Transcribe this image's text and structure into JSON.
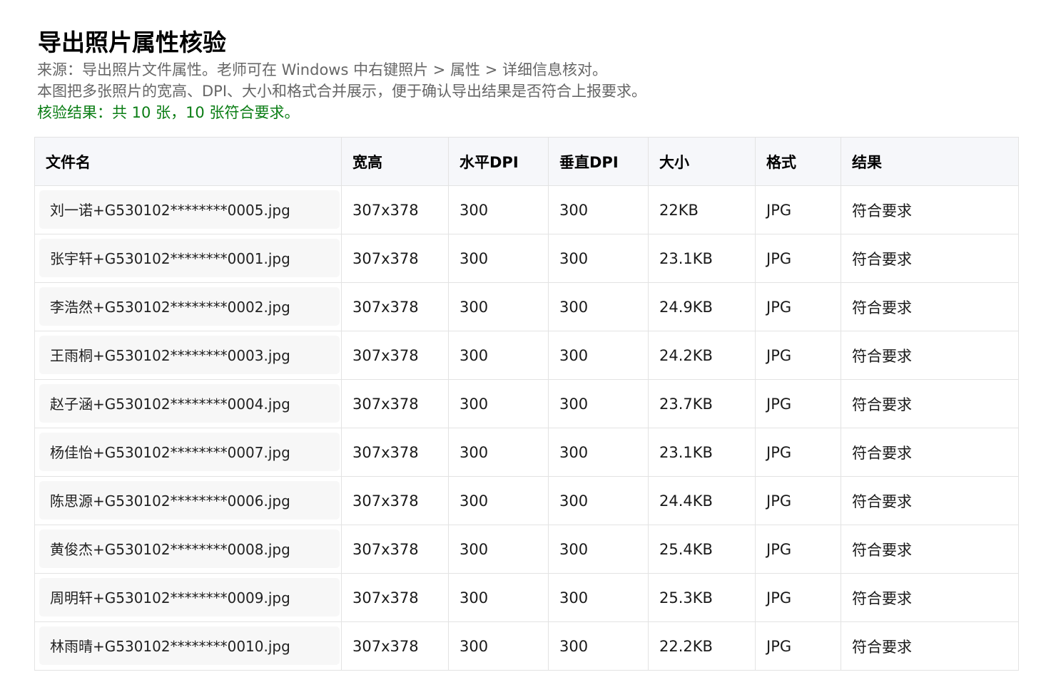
{
  "heading": {
    "title": "导出照片属性核验",
    "source_line": "来源：导出照片文件属性。老师可在 Windows 中右键照片 > 属性 > 详细信息核对。",
    "desc_line": "本图把多张照片的宽高、DPI、大小和格式合并展示，便于确认导出结果是否符合上报要求。",
    "result_line": "核验结果：共 10 张，10 张符合要求。",
    "result_color": "#0a7d14"
  },
  "table": {
    "columns": [
      "文件名",
      "宽高",
      "水平DPI",
      "垂直DPI",
      "大小",
      "格式",
      "结果"
    ],
    "rows": [
      {
        "filename": "刘一诺+G530102********0005.jpg",
        "dims": "307x378",
        "hdpi": "300",
        "vdpi": "300",
        "size": "22KB",
        "format": "JPG",
        "result": "符合要求"
      },
      {
        "filename": "张宇轩+G530102********0001.jpg",
        "dims": "307x378",
        "hdpi": "300",
        "vdpi": "300",
        "size": "23.1KB",
        "format": "JPG",
        "result": "符合要求"
      },
      {
        "filename": "李浩然+G530102********0002.jpg",
        "dims": "307x378",
        "hdpi": "300",
        "vdpi": "300",
        "size": "24.9KB",
        "format": "JPG",
        "result": "符合要求"
      },
      {
        "filename": "王雨桐+G530102********0003.jpg",
        "dims": "307x378",
        "hdpi": "300",
        "vdpi": "300",
        "size": "24.2KB",
        "format": "JPG",
        "result": "符合要求"
      },
      {
        "filename": "赵子涵+G530102********0004.jpg",
        "dims": "307x378",
        "hdpi": "300",
        "vdpi": "300",
        "size": "23.7KB",
        "format": "JPG",
        "result": "符合要求"
      },
      {
        "filename": "杨佳怡+G530102********0007.jpg",
        "dims": "307x378",
        "hdpi": "300",
        "vdpi": "300",
        "size": "23.1KB",
        "format": "JPG",
        "result": "符合要求"
      },
      {
        "filename": "陈思源+G530102********0006.jpg",
        "dims": "307x378",
        "hdpi": "300",
        "vdpi": "300",
        "size": "24.4KB",
        "format": "JPG",
        "result": "符合要求"
      },
      {
        "filename": "黄俊杰+G530102********0008.jpg",
        "dims": "307x378",
        "hdpi": "300",
        "vdpi": "300",
        "size": "25.4KB",
        "format": "JPG",
        "result": "符合要求"
      },
      {
        "filename": "周明轩+G530102********0009.jpg",
        "dims": "307x378",
        "hdpi": "300",
        "vdpi": "300",
        "size": "25.3KB",
        "format": "JPG",
        "result": "符合要求"
      },
      {
        "filename": "林雨晴+G530102********0010.jpg",
        "dims": "307x378",
        "hdpi": "300",
        "vdpi": "300",
        "size": "22.2KB",
        "format": "JPG",
        "result": "符合要求"
      }
    ]
  }
}
